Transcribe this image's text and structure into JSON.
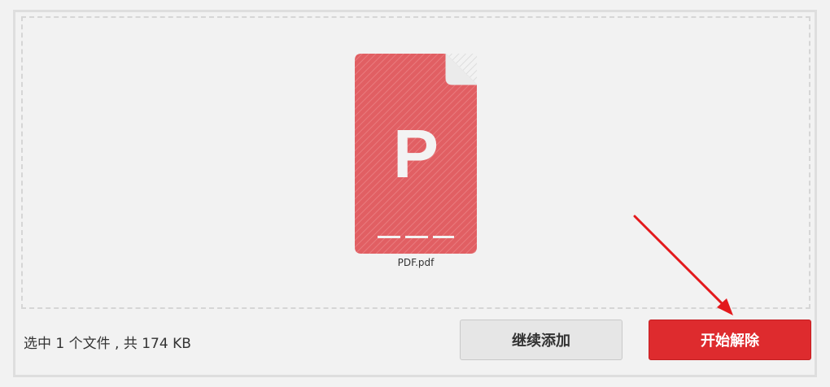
{
  "file": {
    "icon_letter": "P",
    "name": "PDF.pdf",
    "icon_color": "#e05f63"
  },
  "footer": {
    "status": "选中 1 个文件 , 共 174 KB",
    "continue_label": "继续添加",
    "start_label": "开始解除"
  },
  "colors": {
    "accent": "#de2b2e",
    "background": "#f2f2f2"
  },
  "annotation": {
    "icon": "red-arrow-icon"
  }
}
